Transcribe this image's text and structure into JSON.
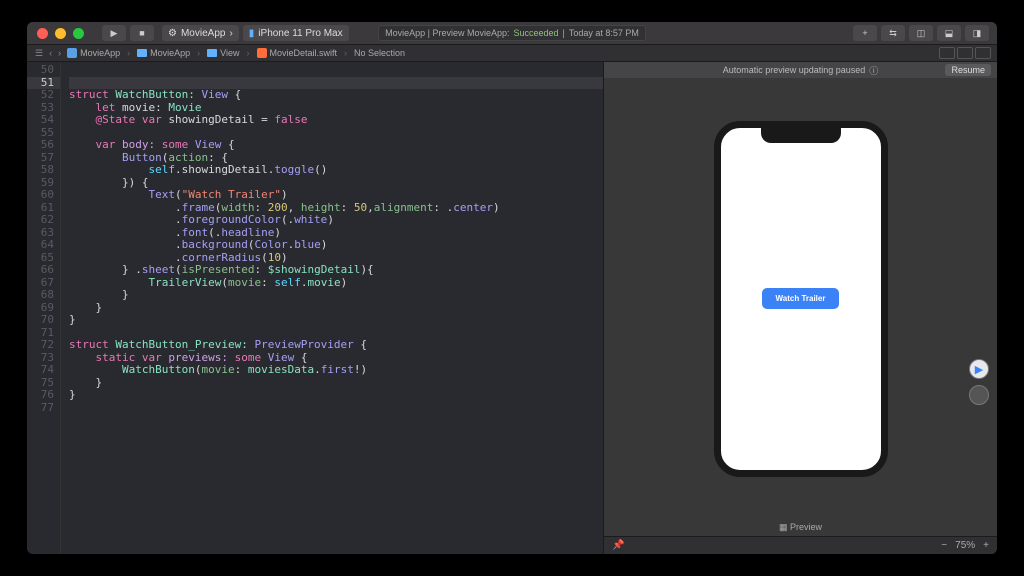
{
  "titlebar": {
    "scheme_app": "MovieApp",
    "scheme_device": "iPhone 11 Pro Max",
    "status_prefix": "MovieApp | Preview MovieApp:",
    "status_result": "Succeeded",
    "status_time": "Today at 8:57 PM"
  },
  "breadcrumb": {
    "items": [
      "MovieApp",
      "MovieApp",
      "View",
      "MovieDetail.swift",
      "No Selection"
    ]
  },
  "editor": {
    "first_line": 50,
    "current_line": 51
  },
  "code": {
    "l52a": "struct",
    "l52b": " WatchButton: ",
    "l52c": "View",
    "l52d": " {",
    "l53a": "let",
    "l53b": " movie: ",
    "l53c": "Movie",
    "l54a": "@State",
    "l54b": " var",
    "l54c": " showingDetail = ",
    "l54d": "false",
    "l56a": "var",
    "l56b": " body: ",
    "l56c": "some",
    "l56d": " View",
    "l56e": " {",
    "l57a": "Button",
    "l57b": "(",
    "l57c": "action",
    "l57d": ": {",
    "l58a": "self",
    "l58b": ".showingDetail.",
    "l58c": "toggle",
    "l58d": "()",
    "l59": "}) {",
    "l60a": "Text",
    "l60b": "(",
    "l60c": "\"Watch Trailer\"",
    "l60d": ")",
    "l61a": ".",
    "l61b": "frame",
    "l61c": "(",
    "l61d": "width",
    "l61e": ": ",
    "l61f": "200",
    "l61g": ", ",
    "l61h": "height",
    "l61i": ": ",
    "l61j": "50",
    "l61k": ",",
    "l61l": "alignment",
    "l61m": ": .",
    "l61n": "center",
    "l61o": ")",
    "l62a": ".",
    "l62b": "foregroundColor",
    "l62c": "(.",
    "l62d": "white",
    "l62e": ")",
    "l63a": ".",
    "l63b": "font",
    "l63c": "(.",
    "l63d": "headline",
    "l63e": ")",
    "l64a": ".",
    "l64b": "background",
    "l64c": "(",
    "l64d": "Color",
    "l64e": ".",
    "l64f": "blue",
    "l64g": ")",
    "l65a": ".",
    "l65b": "cornerRadius",
    "l65c": "(",
    "l65d": "10",
    "l65e": ")",
    "l66a": "} .",
    "l66b": "sheet",
    "l66c": "(",
    "l66d": "isPresented",
    "l66e": ": ",
    "l66f": "$showingDetail",
    "l66g": "){",
    "l67a": "TrailerView",
    "l67b": "(",
    "l67c": "movie",
    "l67d": ": ",
    "l67e": "self",
    "l67f": ".",
    "l67g": "movie",
    "l67h": ")",
    "l68": "}",
    "l69": "}",
    "l70": "}",
    "l72a": "struct",
    "l72b": " WatchButton_Preview: ",
    "l72c": "PreviewProvider",
    "l72d": " {",
    "l73a": "static",
    "l73b": " var",
    "l73c": " previews: ",
    "l73d": "some",
    "l73e": " View",
    "l73f": " {",
    "l74a": "WatchButton",
    "l74b": "(",
    "l74c": "movie",
    "l74d": ": ",
    "l74e": "moviesData",
    "l74f": ".",
    "l74g": "first",
    "l74h": "!)",
    "l75": "}",
    "l76": "}"
  },
  "preview": {
    "banner_text": "Automatic preview updating paused",
    "resume_label": "Resume",
    "button_label": "Watch Trailer",
    "caption": "Preview",
    "zoom": "75%"
  }
}
